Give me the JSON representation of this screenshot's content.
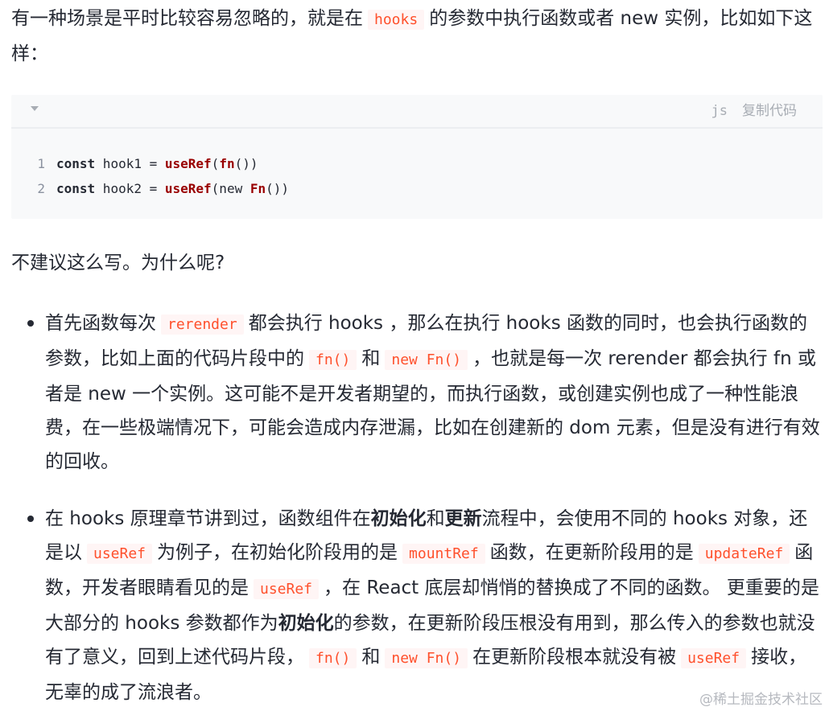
{
  "intro": {
    "before": "有一种场景是平时比较容易忽略的，就是在",
    "code": "hooks",
    "after": "的参数中执行函数或者 new 实例，比如如下这样："
  },
  "code_block": {
    "lang": "js",
    "copy_label": "复制代码",
    "lines": [
      {
        "num": "1",
        "kw": "const",
        "t1": " hook1 = ",
        "fn": "useRef",
        "t2": "(",
        "kw2": "fn",
        "t3": "())"
      },
      {
        "num": "2",
        "kw": "const",
        "t1": " hook2 = ",
        "fn": "useRef",
        "t2": "(new ",
        "kw2": "Fn",
        "t3": "())"
      }
    ]
  },
  "question": "不建议这么写。为什么呢?",
  "bullet1": {
    "a": "首先函数每次",
    "c1": "rerender",
    "b": "都会执行 hooks ，那么在执行 hooks 函数的同时，也会执行函数的参数，比如上面的代码片段中的",
    "c2": "fn()",
    "d": "和",
    "c3": "new Fn()",
    "e": "，也就是每一次 rerender 都会执行 fn 或者是 new 一个实例。这可能不是开发者期望的，而执行函数，或创建实例也成了一种性能浪费，在一些极端情况下，可能会造成内存泄漏，比如在创建新的 dom 元素，但是没有进行有效的回收。"
  },
  "bullet2": {
    "a": "在 hooks 原理章节讲到过，函数组件在",
    "b1": "初始化",
    "a2": "和",
    "b2": "更新",
    "a3": "流程中，会使用不同的 hooks 对象，还是以",
    "c1": "useRef",
    "a4": "为例子，在初始化阶段用的是",
    "c2": "mountRef",
    "a5": "函数，在更新阶段用的是",
    "c3": "updateRef",
    "a6": "函数，开发者眼睛看见的是",
    "c4": "useRef",
    "a7": "，在 React 底层却悄悄的替换成了不同的函数。 更重要的是大部分的 hooks 参数都作为",
    "b3": "初始化",
    "a8": "的参数，在更新阶段压根没有用到，那么传入的参数也就没有了意义，回到上述代码片段，",
    "c5": "fn()",
    "a9": "和",
    "c6": "new Fn()",
    "a10": "在更新阶段根本就没有被",
    "c7": "useRef",
    "a11": "接收， 无辜的成了流浪者。"
  },
  "watermark": "@稀土掘金技术社区"
}
